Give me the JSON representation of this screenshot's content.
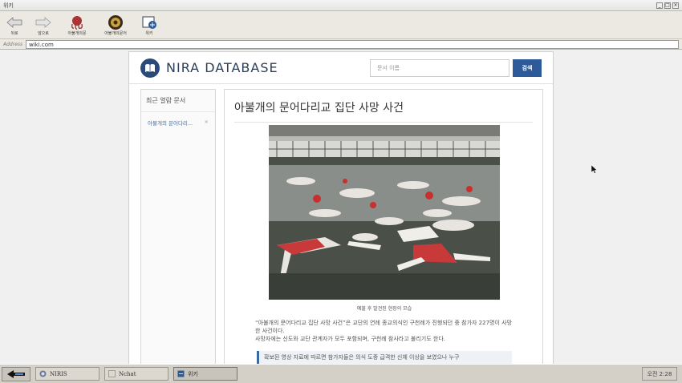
{
  "window": {
    "title": "위키",
    "min": "_",
    "max": "□",
    "close": "×"
  },
  "toolbar": {
    "back_label": "뒤로",
    "forward_label": "앞으로",
    "bookmarks": [
      {
        "label": "아불개의문"
      },
      {
        "label": "아불개의문어"
      },
      {
        "label": "위키"
      }
    ]
  },
  "address": {
    "label": "Address",
    "value": "wiki.com"
  },
  "site": {
    "brand": "NIRA DATABASE",
    "search_placeholder": "문서 이름",
    "search_button": "검색"
  },
  "sidebar": {
    "heading": "최근 열람 문서",
    "items": [
      {
        "label": "아불개의 문어다리...",
        "close": "×"
      }
    ]
  },
  "article": {
    "title": "아불개의 문어다리교 집단 사망 사건",
    "caption": "예불 후 발견된 현장의 모습",
    "paragraph1": "“아불개의 문어다리교 집단 사망 사건”은 교단의 연례 종교의식인 구천례가 진행되던 중 참가자 227명이 사망한 사건이다.",
    "paragraph2": "사망자에는 신도와 교단 관계자가 모두 포함되며, 구천례 참사라고 불리기도 한다.",
    "quote": "확보된 영상 자료에 따르면 참가자들은 의식 도중 급격한 신체 이상을 보였으나 누구"
  },
  "taskbar": {
    "tasks": [
      {
        "label": "NIRIS"
      },
      {
        "label": "Nchat"
      },
      {
        "label": "위키"
      }
    ],
    "clock": "오전 2:28"
  },
  "colors": {
    "accent": "#2e5a99",
    "brand": "#2b3d58"
  }
}
